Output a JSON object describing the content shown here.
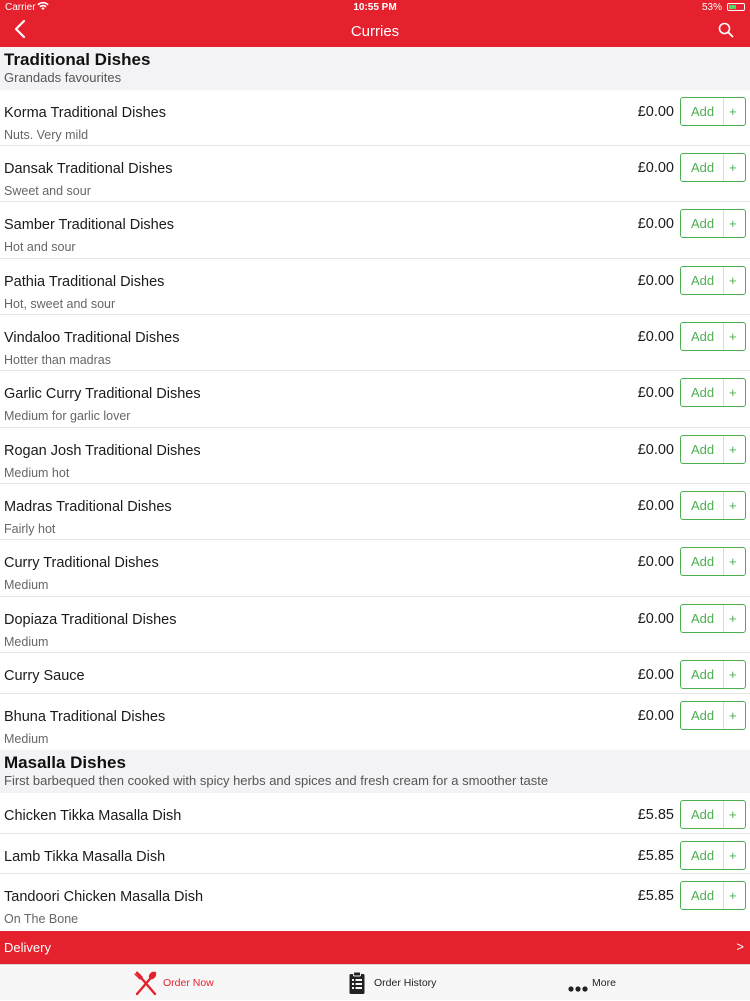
{
  "status": {
    "carrier": "Carrier",
    "time": "10:55 PM",
    "battery": "53%",
    "battery_level": 0.53
  },
  "nav": {
    "title": "Curries"
  },
  "sections": [
    {
      "title": "Traditional Dishes",
      "subtitle": "Grandads favourites"
    },
    {
      "title": "Masalla Dishes",
      "subtitle": "First barbequed then cooked with spicy herbs and spices and fresh cream for a smoother taste"
    }
  ],
  "add_label": "Add",
  "plus_label": "+",
  "items": [
    {
      "name": "Korma Traditional Dishes",
      "desc": "Nuts. Very mild",
      "price": "£0.00"
    },
    {
      "name": "Dansak Traditional Dishes",
      "desc": "Sweet and sour",
      "price": "£0.00"
    },
    {
      "name": "Samber Traditional Dishes",
      "desc": "Hot and sour",
      "price": "£0.00"
    },
    {
      "name": "Pathia Traditional Dishes",
      "desc": "Hot, sweet and sour",
      "price": "£0.00"
    },
    {
      "name": "Vindaloo Traditional Dishes",
      "desc": "Hotter than madras",
      "price": "£0.00"
    },
    {
      "name": "Garlic Curry Traditional Dishes",
      "desc": "Medium for garlic lover",
      "price": "£0.00"
    },
    {
      "name": "Rogan Josh Traditional Dishes",
      "desc": "Medium hot",
      "price": "£0.00"
    },
    {
      "name": "Madras Traditional Dishes",
      "desc": "Fairly hot",
      "price": "£0.00"
    },
    {
      "name": "Curry Traditional Dishes",
      "desc": "Medium",
      "price": "£0.00"
    },
    {
      "name": "Dopiaza Traditional Dishes",
      "desc": "Medium",
      "price": "£0.00"
    },
    {
      "name": "Curry Sauce",
      "desc": "",
      "price": "£0.00"
    },
    {
      "name": "Bhuna Traditional Dishes",
      "desc": "Medium",
      "price": "£0.00"
    },
    {
      "name": "Chicken Tikka Masalla Dish",
      "desc": "",
      "price": "£5.85"
    },
    {
      "name": "Lamb Tikka Masalla Dish",
      "desc": "",
      "price": "£5.85"
    },
    {
      "name": "Tandoori Chicken Masalla Dish",
      "desc": "On The Bone",
      "price": "£5.85"
    }
  ],
  "delivery": {
    "label": "Delivery",
    "chevron": ">"
  },
  "tabs": [
    {
      "label": "Order Now",
      "icon": "fork-knife-icon",
      "active": true
    },
    {
      "label": "Order History",
      "icon": "clipboard-icon",
      "active": false
    },
    {
      "label": "More",
      "icon": "more-dots-icon",
      "active": false
    }
  ],
  "colors": {
    "brand_red": "#e4212c",
    "add_green": "#4caf50",
    "section_bg": "#f3f3f5"
  }
}
